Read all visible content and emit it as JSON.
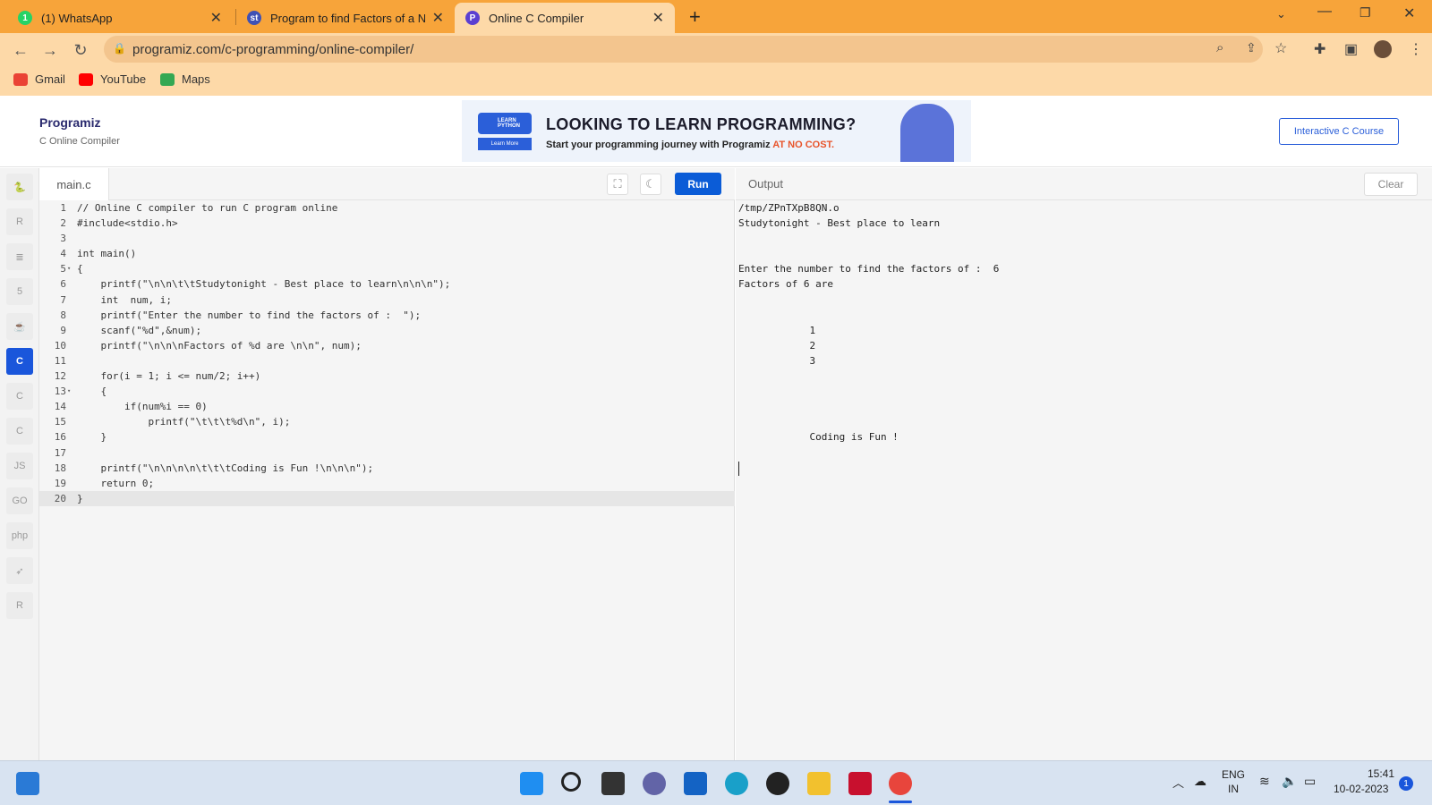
{
  "browser": {
    "tabs": [
      {
        "title": "(1) WhatsApp",
        "favicon_text": "1",
        "favicon_color": "#25d366",
        "active": false
      },
      {
        "title": "Program to find Factors of a Num",
        "favicon_text": "st",
        "favicon_color": "#3f51b5",
        "active": false
      },
      {
        "title": "Online C Compiler",
        "favicon_text": "P",
        "favicon_color": "#5b3fd1",
        "active": true
      }
    ],
    "url": "programiz.com/c-programming/online-compiler/",
    "bookmarks": [
      {
        "label": "Gmail",
        "color": "#ea4335"
      },
      {
        "label": "YouTube",
        "color": "#ff0000"
      },
      {
        "label": "Maps",
        "color": "#34a853"
      }
    ],
    "chrome_color": "#f7a43a"
  },
  "site": {
    "logo": "Programiz",
    "subtitle": "C Online Compiler",
    "banner": {
      "logo_text": "LEARN PYTHON",
      "learn_button": "Learn More",
      "title": "LOOKING TO LEARN PROGRAMMING?",
      "subtitle_prefix": "Start your programming journey with Programiz ",
      "subtitle_highlight": "AT NO COST."
    },
    "course_button": "Interactive C Course"
  },
  "sidebar": {
    "languages": [
      {
        "name": "python-icon",
        "glyph": "🐍"
      },
      {
        "name": "r-icon",
        "glyph": "R"
      },
      {
        "name": "sql-icon",
        "glyph": "≣"
      },
      {
        "name": "html-icon",
        "glyph": "5"
      },
      {
        "name": "java-icon",
        "glyph": "☕"
      },
      {
        "name": "c-icon",
        "glyph": "C",
        "active": true
      },
      {
        "name": "cpp-icon",
        "glyph": "C"
      },
      {
        "name": "csharp-icon",
        "glyph": "C"
      },
      {
        "name": "javascript-icon",
        "glyph": "JS"
      },
      {
        "name": "go-icon",
        "glyph": "GO"
      },
      {
        "name": "php-icon",
        "glyph": "php"
      },
      {
        "name": "swift-icon",
        "glyph": "➶"
      },
      {
        "name": "rust-icon",
        "glyph": "R"
      }
    ]
  },
  "editor": {
    "filename": "main.c",
    "run_label": "Run",
    "fullscreen_glyph": "⛶",
    "theme_glyph": "☾",
    "active_line": 20,
    "lines": [
      {
        "n": "1",
        "code": "// Online C compiler to run C program online",
        "fold": ""
      },
      {
        "n": "2",
        "code": "#include<stdio.h>",
        "fold": ""
      },
      {
        "n": "3",
        "code": "",
        "fold": ""
      },
      {
        "n": "4",
        "code": "int main()",
        "fold": ""
      },
      {
        "n": "5",
        "code": "{",
        "fold": "▾"
      },
      {
        "n": "6",
        "code": "    printf(\"\\n\\n\\t\\tStudytonight - Best place to learn\\n\\n\\n\");",
        "fold": ""
      },
      {
        "n": "7",
        "code": "    int  num, i;",
        "fold": ""
      },
      {
        "n": "8",
        "code": "    printf(\"Enter the number to find the factors of :  \");",
        "fold": ""
      },
      {
        "n": "9",
        "code": "    scanf(\"%d\",&num);",
        "fold": ""
      },
      {
        "n": "10",
        "code": "    printf(\"\\n\\n\\nFactors of %d are \\n\\n\", num);",
        "fold": ""
      },
      {
        "n": "11",
        "code": "",
        "fold": ""
      },
      {
        "n": "12",
        "code": "    for(i = 1; i <= num/2; i++)",
        "fold": ""
      },
      {
        "n": "13",
        "code": "    {",
        "fold": "▾"
      },
      {
        "n": "14",
        "code": "        if(num%i == 0)",
        "fold": ""
      },
      {
        "n": "15",
        "code": "            printf(\"\\t\\t\\t%d\\n\", i);",
        "fold": ""
      },
      {
        "n": "16",
        "code": "    }",
        "fold": ""
      },
      {
        "n": "17",
        "code": "",
        "fold": ""
      },
      {
        "n": "18",
        "code": "    printf(\"\\n\\n\\n\\n\\t\\t\\tCoding is Fun !\\n\\n\\n\");",
        "fold": ""
      },
      {
        "n": "19",
        "code": "    return 0;",
        "fold": ""
      },
      {
        "n": "20",
        "code": "}",
        "fold": ""
      }
    ]
  },
  "output": {
    "title": "Output",
    "clear_label": "Clear",
    "lines": [
      "/tmp/ZPnTXpB8QN.o",
      "Studytonight - Best place to learn",
      "",
      "",
      "Enter the number to find the factors of :  6",
      "Factors of 6 are",
      "",
      "",
      "            1",
      "            2",
      "            3",
      "",
      "",
      "",
      "",
      "            Coding is Fun !"
    ]
  },
  "taskbar": {
    "language": "ENG",
    "region": "IN",
    "time": "15:41",
    "date": "10-02-2023",
    "notifications": "1"
  }
}
